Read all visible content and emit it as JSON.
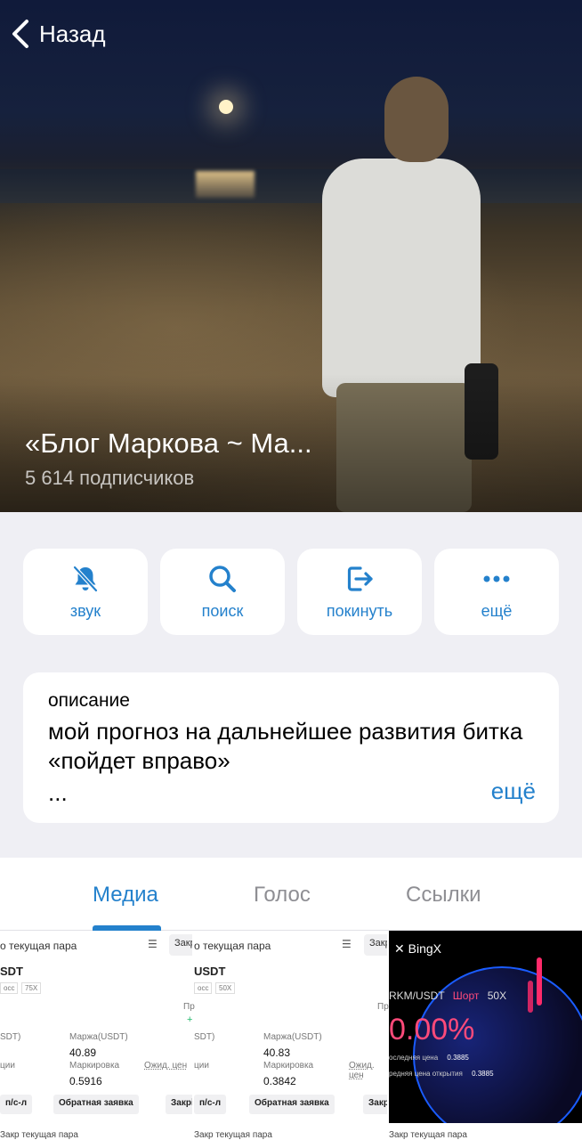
{
  "nav": {
    "back_label": "Назад"
  },
  "channel": {
    "title": "«Блог Маркова ~ Ма...",
    "subscribers": "5 614 подписчиков"
  },
  "actions": [
    {
      "label": "звук",
      "icon": "bell-slash-icon"
    },
    {
      "label": "поиск",
      "icon": "search-icon"
    },
    {
      "label": "покинуть",
      "icon": "leave-icon"
    },
    {
      "label": "ещё",
      "icon": "more-icon"
    }
  ],
  "description": {
    "label": "описание",
    "text": "мой прогноз на дальнейшее развития битка «пойдет вправо»",
    "ellipsis": "...",
    "more": "ещё"
  },
  "tabs": [
    {
      "label": "Медиа",
      "active": true
    },
    {
      "label": "Голос",
      "active": false
    },
    {
      "label": "Ссылки",
      "active": false
    }
  ],
  "media": {
    "tile1": {
      "head": "о текущая пара",
      "close": "Закр",
      "pair": "SDT",
      "tag1": "осс",
      "tag2": "75X",
      "pr": "Пр",
      "margin_label": "Маржа(USDT)",
      "margin_value": "40.89",
      "sdt": "SDT)",
      "mark_label": "Маркировка",
      "mark_value": "0.5916",
      "expect": "Ожид. цен",
      "cii": "ции",
      "btn1": "п/с-л",
      "btn2": "Обратная заявка",
      "btn3": "Закрі"
    },
    "tile2": {
      "head": "о текущая пара",
      "close": "Закр",
      "pair": "USDT",
      "tag1": "осс",
      "tag2": "50X",
      "pr": "Пр",
      "margin_label": "Маржа(USDT)",
      "margin_value": "40.83",
      "sdt": "SDT)",
      "mark_label": "Маркировка",
      "mark_value": "0.3842",
      "expect": "Ожид. цен",
      "cii": "ции",
      "btn1": "п/с-л",
      "btn2": "Обратная заявка",
      "btn3": "Закр"
    },
    "tile3": {
      "logo": "BingX",
      "pair": "RKM/USDT",
      "side": "Шорт",
      "lev": "50X",
      "pct": "0.00%",
      "last_label": "оследняя цена",
      "last_value": "0.3885",
      "open_label": "редняя цена открытия",
      "open_value": "0.3885"
    },
    "row2_text": "Закр текущая пара"
  },
  "colors": {
    "accent": "#2481cc",
    "background": "#efeff4",
    "bingx_pink": "#ff4a7a"
  }
}
